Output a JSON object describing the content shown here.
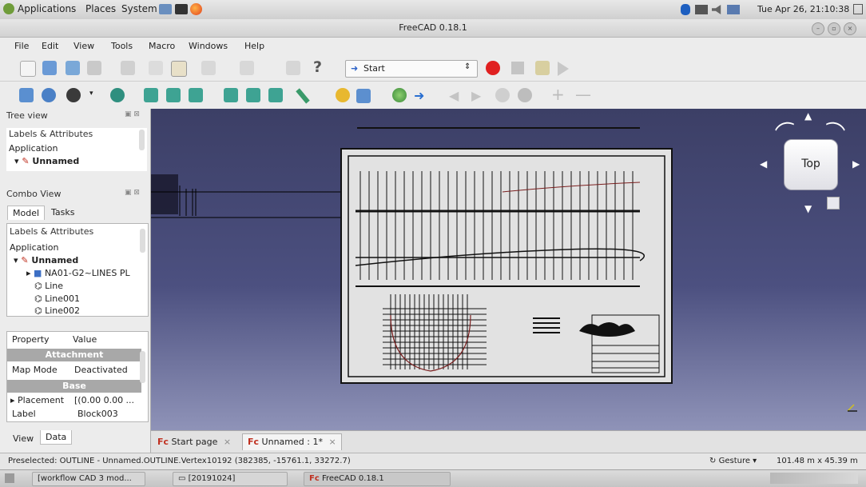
{
  "top_panel": {
    "menus": [
      "Applications",
      "Places",
      "System"
    ],
    "clock": "Tue Apr 26, 21:10:38"
  },
  "window": {
    "title": "FreeCAD 0.18.1"
  },
  "menubar": [
    "File",
    "Edit",
    "View",
    "Tools",
    "Macro",
    "Windows",
    "Help"
  ],
  "toolbar": {
    "workbench": "Start"
  },
  "tree_view": {
    "title": "Tree view",
    "header": "Labels & Attributes",
    "root": "Application",
    "doc": "Unnamed"
  },
  "combo_view": {
    "title": "Combo View",
    "tabs": [
      "Model",
      "Tasks"
    ],
    "header": "Labels & Attributes",
    "root": "Application",
    "doc": "Unnamed",
    "items": [
      "NA01-G2~LINES PL",
      "Line",
      "Line001",
      "Line002"
    ]
  },
  "properties": {
    "col_property": "Property",
    "col_value": "Value",
    "section1": "Attachment",
    "map_mode_label": "Map Mode",
    "map_mode_value": "Deactivated",
    "section2": "Base",
    "placement_label": "Placement",
    "placement_value": "[(0.00 0.00 ...",
    "label_label": "Label",
    "label_value": "Block003",
    "tabs": [
      "View",
      "Data"
    ]
  },
  "navcube": {
    "face": "Top"
  },
  "doc_tabs": [
    "Start page",
    "Unnamed : 1*"
  ],
  "status": {
    "message": "Preselected: OUTLINE - Unnamed.OUTLINE.Vertex10192 (382385, -15761.1, 33272.7)",
    "nav_style": "Gesture",
    "dimensions": "101.48 m x 45.39 m"
  },
  "taskbar": [
    "[workflow CAD 3 mod...",
    "[20191024]",
    "FreeCAD 0.18.1"
  ]
}
